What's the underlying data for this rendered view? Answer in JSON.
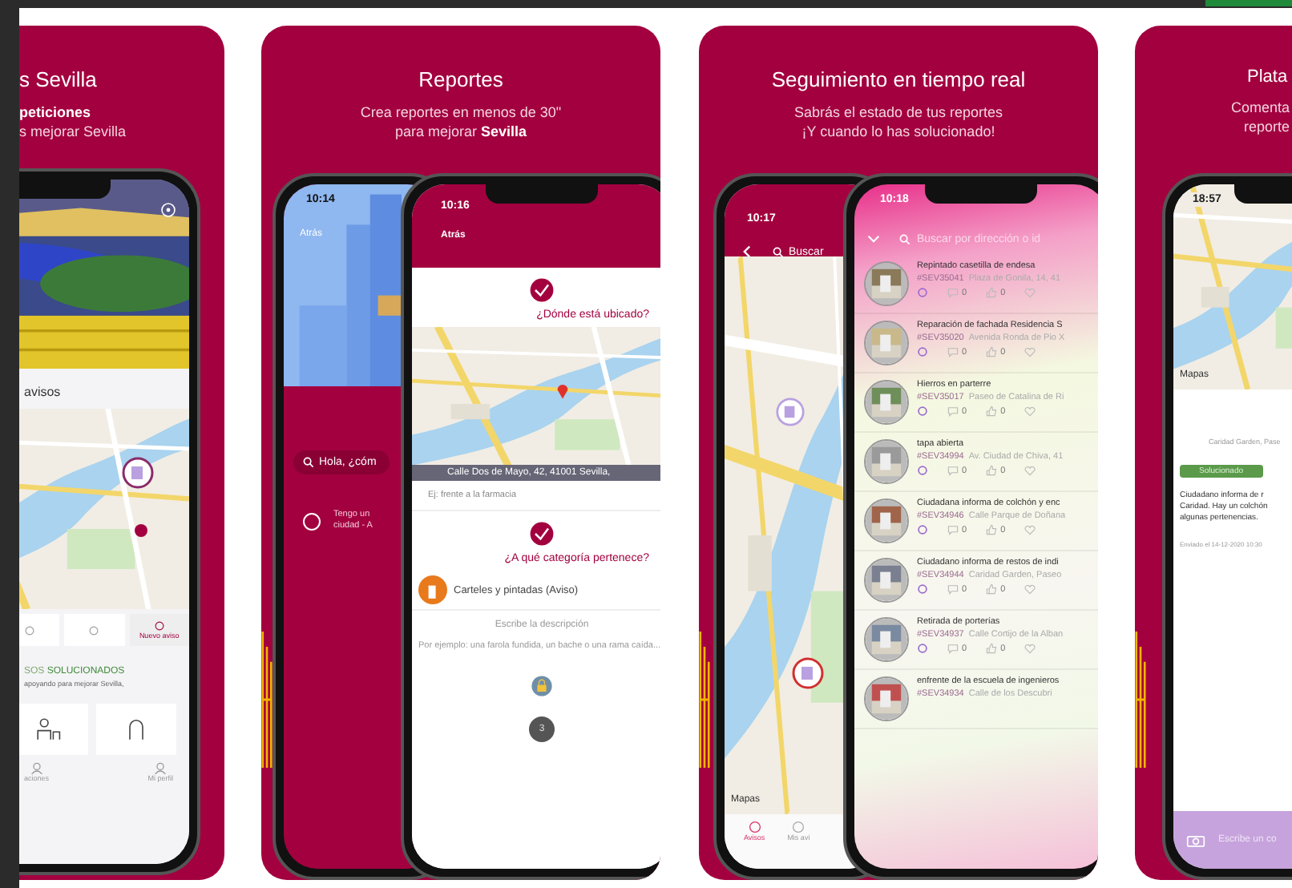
{
  "cards": [
    {
      "kind": "home",
      "title": "s Sevilla",
      "lines": [
        {
          "text": "peticiones",
          "bold": true
        },
        {
          "text": "s mejorar Sevilla",
          "bold": false
        }
      ],
      "screen": {
        "section": "avisos",
        "tabs": [
          {
            "selected": false
          },
          {
            "selected": false
          },
          {
            "label": "Nuevo aviso",
            "selected": true
          }
        ],
        "solved_prefix": "SOS",
        "solved": "SOLUCIONADOS",
        "solved_note": "apoyando para mejorar Sevilla,",
        "nav": [
          "aciones",
          "Mi perfil"
        ]
      }
    },
    {
      "kind": "report",
      "title": "Reportes",
      "lines": [
        {
          "text": "Crea reportes en menos de 30\"",
          "bold": false
        },
        {
          "text": "para mejorar **Sevilla**",
          "bold": false
        }
      ],
      "back": {
        "time": "10:14",
        "back": "Atrás",
        "search": "Hola, ¿cóm",
        "option": [
          "Tengo un",
          "ciudad - A"
        ],
        "option_checked": false
      },
      "front": {
        "time": "10:16",
        "back": "Atrás",
        "q1": "¿Dónde está ubicado?",
        "address": "Calle Dos de Mayo, 42, 41001 Sevilla,",
        "ref_placeholder": "Ej: frente a la farmacia",
        "q2": "¿A qué categoría pertenece?",
        "category": "Carteles y pintadas (Aviso)",
        "desc_title": "Escribe la descripción",
        "desc_placeholder": "Por ejemplo: una farola fundida, un bache o una rama caída...",
        "step": "3"
      }
    },
    {
      "kind": "tracking",
      "title": "Seguimiento en tiempo real",
      "lines": [
        {
          "text": "Sabrás el estado de tus reportes",
          "bold": false
        },
        {
          "text": "¡Y cuando lo has solucionado!",
          "bold": false
        }
      ],
      "back": {
        "time": "10:17",
        "search": "Buscar",
        "maps": "Mapas",
        "nav": [
          {
            "label": "Avisos",
            "selected": true
          },
          {
            "label": "Mis avi",
            "selected": false
          }
        ]
      },
      "front": {
        "time": "10:18",
        "search": "Buscar por dirección o id",
        "reports": [
          {
            "title": "Repintado casetilla de endesa",
            "id": "#SEV35041",
            "address": "Plaza de Gonila, 14, 41",
            "comments": "0",
            "likes": "0"
          },
          {
            "title": "Reparación de fachada Residencia S",
            "id": "#SEV35020",
            "address": "Avenida Ronda de Pio X",
            "comments": "0",
            "likes": "0"
          },
          {
            "title": "Hierros en parterre",
            "id": "#SEV35017",
            "address": "Paseo de Catalina de Ri",
            "comments": "0",
            "likes": "0"
          },
          {
            "title": "tapa abierta",
            "id": "#SEV34994",
            "address": "Av. Ciudad de Chiva, 41",
            "comments": "0",
            "likes": "0"
          },
          {
            "title": "Ciudadana informa de colchón y enc",
            "id": "#SEV34946",
            "address": "Calle Parque de Doñana",
            "comments": "0",
            "likes": "0"
          },
          {
            "title": "Ciudadano informa de restos de indi",
            "id": "#SEV34944",
            "address": "Caridad Garden, Paseo",
            "comments": "0",
            "likes": "0"
          },
          {
            "title": "Retirada de porterías",
            "id": "#SEV34937",
            "address": "Calle Cortijo de la Alban",
            "comments": "0",
            "likes": "0"
          },
          {
            "title": "enfrente de la escuela de ingenieros",
            "id": "#SEV34934",
            "address": "Calle de los Descubri"
          }
        ]
      }
    },
    {
      "kind": "detail",
      "title": "Plata",
      "lines": [
        {
          "text": "Comenta",
          "bold": false
        },
        {
          "text": "reporte",
          "bold": false
        }
      ],
      "screen": {
        "time": "18:57",
        "maps": "Mapas",
        "place": "Caridad Garden, Pase",
        "status": "Solucionado",
        "body": [
          "Ciudadano informa de r",
          "Caridad. Hay un colchón",
          "algunas pertenencias."
        ],
        "sent": "Enviado el 14-12-2020 10:30",
        "comment_placeholder": "Escribe un co"
      }
    }
  ]
}
